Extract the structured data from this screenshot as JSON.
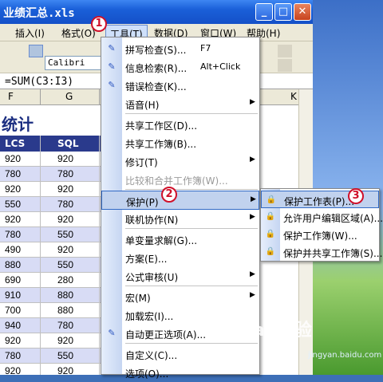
{
  "window": {
    "title": "业绩汇总.xls"
  },
  "menubar": {
    "items": [
      "插入(I)",
      "格式(O)",
      "工具(T)",
      "数据(D)",
      "窗口(W)",
      "帮助(H)"
    ]
  },
  "toolbar": {
    "font": "Calibri"
  },
  "formula": {
    "text": "=SUM(C3:I3)"
  },
  "columns": [
    "F",
    "G",
    "K"
  ],
  "sheet": {
    "title": "统计",
    "headers": [
      "LCS",
      "SQL"
    ],
    "rows": [
      [
        "920",
        "920"
      ],
      [
        "780",
        "780"
      ],
      [
        "920",
        "920"
      ],
      [
        "550",
        "780"
      ],
      [
        "920",
        "920"
      ],
      [
        "780",
        "550"
      ],
      [
        "490",
        "920"
      ],
      [
        "880",
        "550"
      ],
      [
        "690",
        "280"
      ],
      [
        "910",
        "880"
      ],
      [
        "700",
        "880"
      ],
      [
        "940",
        "780"
      ],
      [
        "920",
        "920"
      ],
      [
        "780",
        "550"
      ],
      [
        "920",
        "920"
      ]
    ]
  },
  "tools_menu": {
    "items": [
      {
        "label": "拼写检查(S)...",
        "shortcut": "F7",
        "icon": "spell-check-icon"
      },
      {
        "label": "信息检索(R)...",
        "shortcut": "Alt+Click",
        "icon": "research-icon"
      },
      {
        "label": "错误检查(K)...",
        "icon": "error-check-icon"
      },
      {
        "label": "语音(H)",
        "submenu": true
      },
      {
        "label": "共享工作区(D)..."
      },
      {
        "label": "共享工作簿(B)..."
      },
      {
        "label": "修订(T)",
        "submenu": true
      },
      {
        "label": "比较和合并工作簿(W)...",
        "disabled": true
      },
      {
        "label": "保护(P)",
        "submenu": true,
        "highlighted": true
      },
      {
        "label": "联机协作(N)",
        "submenu": true
      },
      {
        "label": "单变量求解(G)..."
      },
      {
        "label": "方案(E)..."
      },
      {
        "label": "公式审核(U)",
        "submenu": true
      },
      {
        "label": "宏(M)",
        "submenu": true
      },
      {
        "label": "加载宏(I)..."
      },
      {
        "label": "自动更正选项(A)...",
        "icon": "autocorrect-icon"
      },
      {
        "label": "自定义(C)..."
      },
      {
        "label": "选项(O)..."
      }
    ]
  },
  "protect_submenu": {
    "items": [
      {
        "label": "保护工作表(P)...",
        "highlighted": true
      },
      {
        "label": "允许用户编辑区域(A)..."
      },
      {
        "label": "保护工作簿(W)..."
      },
      {
        "label": "保护并共享工作簿(S)..."
      }
    ]
  },
  "badges": [
    "1",
    "2",
    "3"
  ],
  "watermark": {
    "text": "Bai 经验",
    "sub": "jingyan.baidu.com"
  }
}
